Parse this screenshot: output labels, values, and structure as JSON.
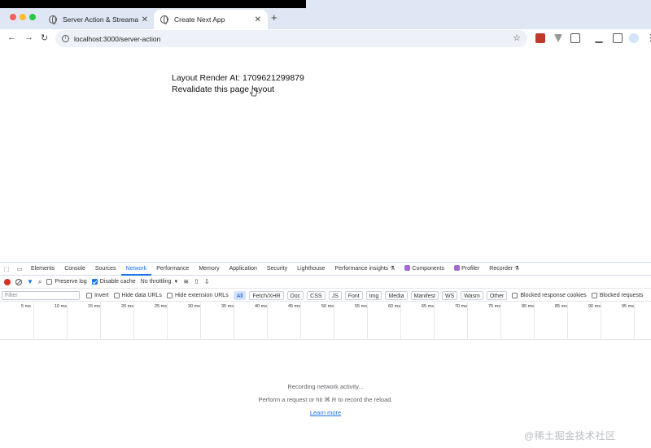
{
  "browser": {
    "tabs": [
      {
        "title": "Server Action & Streamable U",
        "close": "✕",
        "active": false
      },
      {
        "title": "Create Next App",
        "close": "✕",
        "active": true
      }
    ],
    "new_tab": "+",
    "url": "localhost:3000/server-action",
    "icons": [
      "back-arrow-icon",
      "forward-arrow-icon",
      "reload-icon",
      "site-info-icon",
      "bookmark-star-icon",
      "extensions-icon",
      "labs-icon",
      "side-panel-icon",
      "profile-icon",
      "menu-icon"
    ],
    "accent": "#dfe7f5"
  },
  "page": {
    "layout_render": "Layout Render At: 1709621299879",
    "revalidate_link": "Revalidate this page layout"
  },
  "devtools": {
    "tabs": [
      {
        "label": "Elements"
      },
      {
        "label": "Console"
      },
      {
        "label": "Sources"
      },
      {
        "label": "Network",
        "active": true
      },
      {
        "label": "Performance"
      },
      {
        "label": "Memory"
      },
      {
        "label": "Application"
      },
      {
        "label": "Security"
      },
      {
        "label": "Lighthouse"
      },
      {
        "label": "Performance insights ⚗"
      },
      {
        "label": "Components",
        "badge": true
      },
      {
        "label": "Profiler",
        "badge": true
      },
      {
        "label": "Recorder ⚗"
      }
    ],
    "network_toolbar": {
      "preserve_log": "Preserve log",
      "disable_cache": "Disable cache",
      "disable_cache_checked": true,
      "throttling": "No throttling"
    },
    "filter_bar": {
      "placeholder": "Filter",
      "invert": "Invert",
      "hide_data_urls": "Hide data URLs",
      "hide_extension_urls": "Hide extension URLs",
      "types": [
        "All",
        "Fetch/XHR",
        "Doc",
        "CSS",
        "JS",
        "Font",
        "Img",
        "Media",
        "Manifest",
        "WS",
        "Wasm",
        "Other"
      ],
      "blocked_response_cookies": "Blocked response cookies",
      "blocked_requests": "Blocked requests"
    },
    "timeline_ticks": [
      "5 ms",
      "10 ms",
      "15 ms",
      "20 ms",
      "25 ms",
      "30 ms",
      "35 ms",
      "40 ms",
      "45 ms",
      "50 ms",
      "55 ms",
      "60 ms",
      "65 ms",
      "70 ms",
      "75 ms",
      "80 ms",
      "85 ms",
      "90 ms",
      "95 ms"
    ],
    "empty_state": {
      "recording": "Recording network activity...",
      "hint": "Perform a request or hit ⌘ R to record the reload.",
      "learn_more": "Learn more"
    }
  },
  "watermark": "@稀土掘金技术社区"
}
